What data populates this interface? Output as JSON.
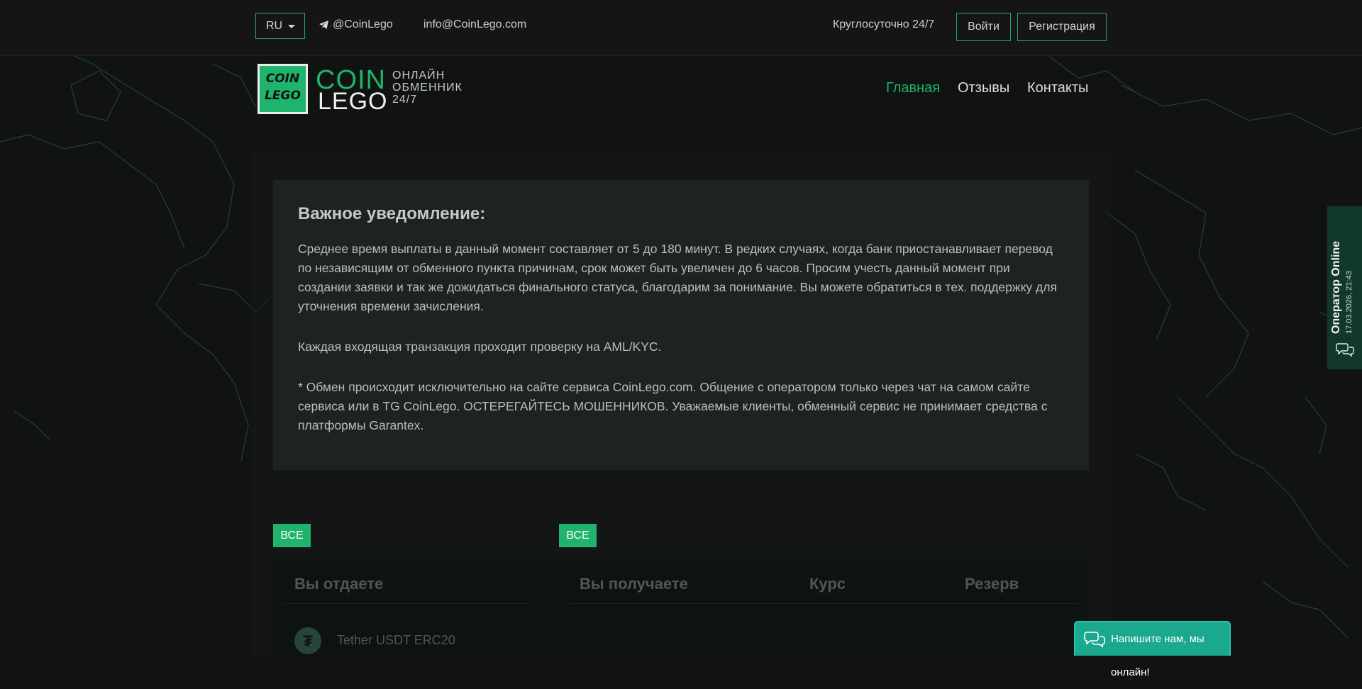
{
  "topbar": {
    "language": "RU",
    "telegram": "@CoinLego",
    "email": "info@CoinLego.com",
    "hours": "Круглосуточно 24/7",
    "login": "Войти",
    "register": "Регистрация"
  },
  "logo": {
    "badge_top": "COIN",
    "badge_bottom": "LEGO",
    "word_coin": "COIN",
    "word_lego": "LEGO",
    "tagline": [
      "ОНЛАЙН",
      "ОБМЕННИК",
      "24/7"
    ]
  },
  "nav": {
    "items": [
      "Главная",
      "Отзывы",
      "Контакты"
    ],
    "active": "Главная"
  },
  "notice": {
    "title": "Важное уведомление:",
    "paragraphs": [
      "Среднее время выплаты в данный момент составляет от 5 до 180 минут. В редких случаях, когда банк приостанавливает перевод по независящим от обменного пункта причинам, срок может быть увеличен до 6 часов. Просим учесть данный момент при создании заявки и так же дожидаться финального статуса, благодарим за понимание. Вы можете обратиться в тех. поддержку для уточнения времени зачисления.",
      "Каждая входящая транзакция проходит проверку на AML/KYC.",
      "* Обмен происходит исключительно на сайте сервиса CoinLego.com. Общение с оператором только через чат на самом сайте сервиса или в TG CoinLego. ОСТЕРЕГАЙТЕСЬ МОШЕННИКОВ. Уважаемые клиенты, обменный сервис не принимает средства с платформы Garantex."
    ]
  },
  "exchange": {
    "filter_left": "ВСЕ",
    "filter_right": "ВСЕ",
    "col_give": "Вы отдаете",
    "col_receive": "Вы получаете",
    "col_rate": "Курс",
    "col_reserve": "Резерв",
    "first_currency": "Tether USDT ERC20"
  },
  "operator": {
    "title": "Оператор Online",
    "datetime": "17.03.2026, 21:43"
  },
  "chat": {
    "label": "Напишите нам, мы онлайн!"
  },
  "colors": {
    "accent": "#1fb36d",
    "chat": "#1aa88e",
    "operator_bg": "#12382c"
  }
}
